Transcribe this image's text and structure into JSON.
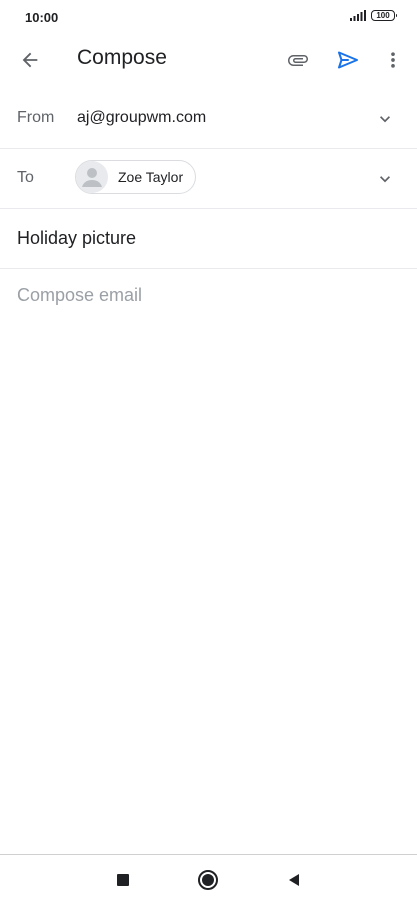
{
  "status_bar": {
    "time": "10:00",
    "battery": "100",
    "signal_icon": "signal-icon"
  },
  "app_bar": {
    "title": "Compose",
    "back_icon": "back-arrow-icon",
    "attach_icon": "paperclip-icon",
    "send_icon": "send-icon",
    "more_icon": "more-vert-icon",
    "send_color": "#1a73e8"
  },
  "from": {
    "label": "From",
    "value": "aj@groupwm.com"
  },
  "to": {
    "label": "To",
    "recipient": {
      "name": "Zoe Taylor",
      "avatar_icon": "person-icon"
    }
  },
  "subject": {
    "value": "Holiday picture"
  },
  "body": {
    "placeholder": "Compose email"
  },
  "nav_bar": {
    "recents_icon": "square-icon",
    "home_icon": "circle-icon",
    "back_icon": "triangle-back-icon"
  }
}
